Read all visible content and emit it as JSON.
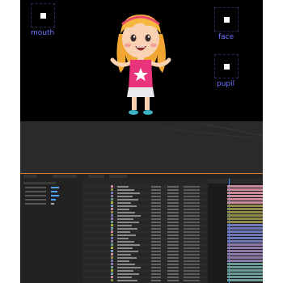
{
  "controls": {
    "mouth": {
      "label": "mouth"
    },
    "face": {
      "label": "face"
    },
    "pupil": {
      "label": "pupil"
    }
  },
  "colors": {
    "canvas_bg": "#000000",
    "control_label": "#6f74ff",
    "accent_orange": "#e07a2e",
    "bar_pink": "#c98a9a",
    "bar_olive": "#8f8a4a",
    "bar_blue": "#6f78b8",
    "bar_purple": "#8e7aa8",
    "bar_teal": "#6c9a94"
  },
  "icons": [
    "mouth-control-icon",
    "face-control-icon",
    "pupil-control-icon",
    "character-illustration-icon"
  ]
}
